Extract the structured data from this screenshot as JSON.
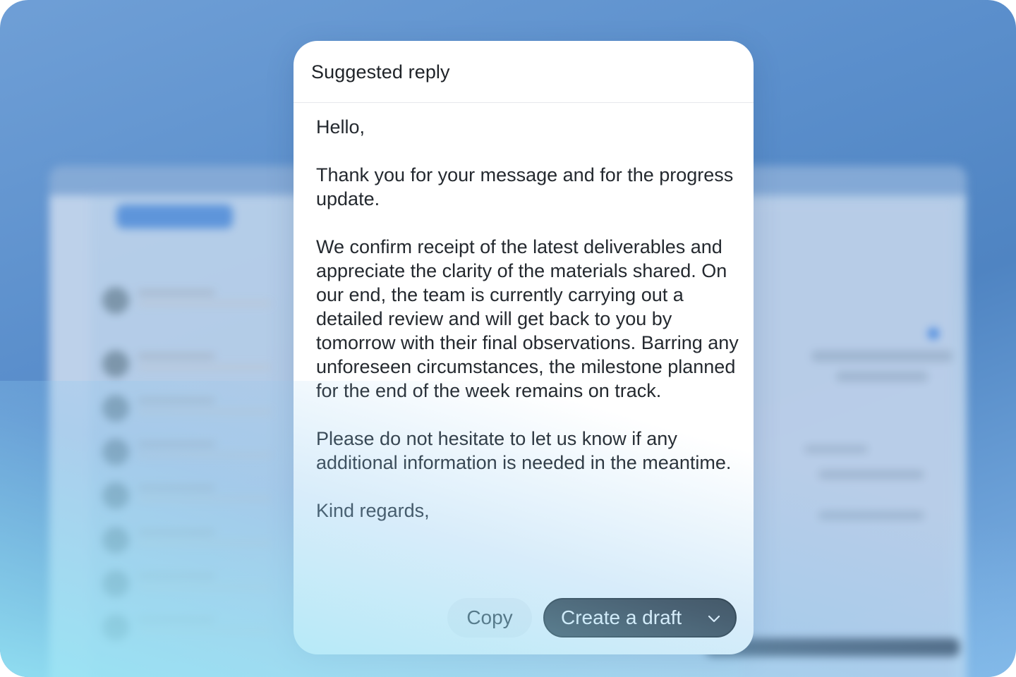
{
  "dialog": {
    "title": "Suggested reply",
    "body": [
      "Hello,",
      "Thank you for your message and for the progress update.",
      "We confirm receipt of the latest deliverables and appreciate the clarity of the materials shared. On our end, the team is currently carrying out a detailed review and will get back to you by tomorrow with their final observations. Barring any unforeseen circumstances, the milestone planned for the end of the week remains on track.",
      "Please do not hesitate to let us know if any additional information is needed in the meantime.",
      "Kind regards,"
    ],
    "actions": {
      "copy_label": "Copy",
      "create_draft_label": "Create a draft",
      "create_draft_icon": "chevron-down-icon"
    }
  },
  "colors": {
    "dialog_background": "#ffffff",
    "primary_button": "#262a30",
    "secondary_button": "#f3f4f6",
    "backdrop_accent": "#5b8fcc"
  }
}
